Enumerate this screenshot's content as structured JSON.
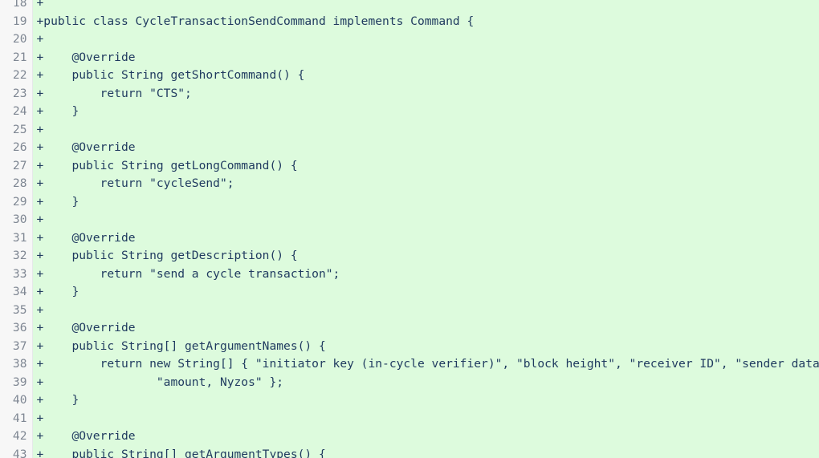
{
  "view": {
    "kind": "code-diff",
    "hunk_state": "addition",
    "colors": {
      "addition_background": "#ddfbdd",
      "gutter_background": "#f7f7f7",
      "gutter_border": "#e6e8ea",
      "line_number_text": "#7f8793",
      "code_text": "#1f3a5f",
      "page_background": "#ffffff"
    }
  },
  "gutter": {
    "name": "line-number-gutter",
    "first_visible_line": "18",
    "last_visible_line": "43"
  },
  "diff": {
    "marker": "+",
    "lines": [
      {
        "number": "18",
        "marker": "+",
        "code": ""
      },
      {
        "number": "19",
        "marker": "+",
        "code": "public class CycleTransactionSendCommand implements Command {"
      },
      {
        "number": "20",
        "marker": "+",
        "code": ""
      },
      {
        "number": "21",
        "marker": "+",
        "code": "    @Override"
      },
      {
        "number": "22",
        "marker": "+",
        "code": "    public String getShortCommand() {"
      },
      {
        "number": "23",
        "marker": "+",
        "code": "        return \"CTS\";"
      },
      {
        "number": "24",
        "marker": "+",
        "code": "    }"
      },
      {
        "number": "25",
        "marker": "+",
        "code": ""
      },
      {
        "number": "26",
        "marker": "+",
        "code": "    @Override"
      },
      {
        "number": "27",
        "marker": "+",
        "code": "    public String getLongCommand() {"
      },
      {
        "number": "28",
        "marker": "+",
        "code": "        return \"cycleSend\";"
      },
      {
        "number": "29",
        "marker": "+",
        "code": "    }"
      },
      {
        "number": "30",
        "marker": "+",
        "code": ""
      },
      {
        "number": "31",
        "marker": "+",
        "code": "    @Override"
      },
      {
        "number": "32",
        "marker": "+",
        "code": "    public String getDescription() {"
      },
      {
        "number": "33",
        "marker": "+",
        "code": "        return \"send a cycle transaction\";"
      },
      {
        "number": "34",
        "marker": "+",
        "code": "    }"
      },
      {
        "number": "35",
        "marker": "+",
        "code": ""
      },
      {
        "number": "36",
        "marker": "+",
        "code": "    @Override"
      },
      {
        "number": "37",
        "marker": "+",
        "code": "    public String[] getArgumentNames() {"
      },
      {
        "number": "38",
        "marker": "+",
        "code": "        return new String[] { \"initiator key (in-cycle verifier)\", \"block height\", \"receiver ID\", \"sender data\","
      },
      {
        "number": "39",
        "marker": "+",
        "code": "                \"amount, Nyzos\" };"
      },
      {
        "number": "40",
        "marker": "+",
        "code": "    }"
      },
      {
        "number": "41",
        "marker": "+",
        "code": ""
      },
      {
        "number": "42",
        "marker": "+",
        "code": "    @Override"
      },
      {
        "number": "43",
        "marker": "+",
        "code": "    public String[] getArgumentTypes() {"
      }
    ]
  }
}
